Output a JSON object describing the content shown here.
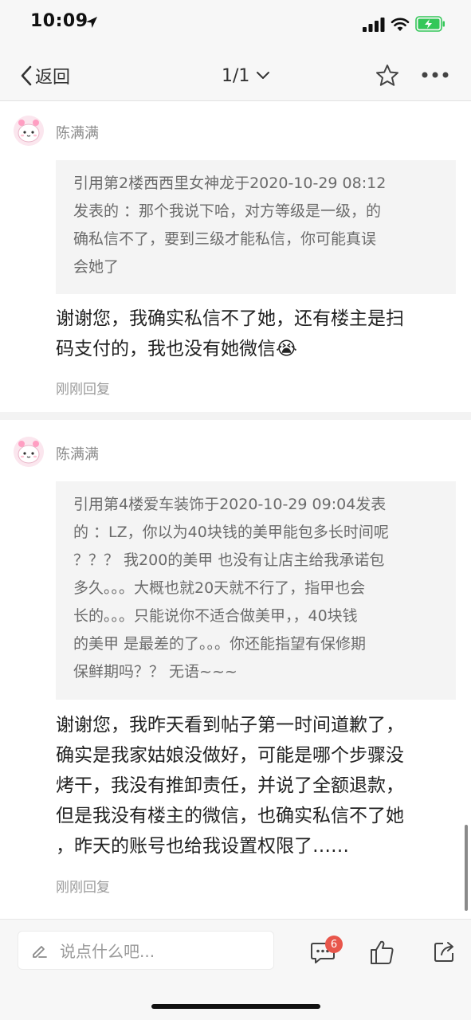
{
  "status_bar": {
    "time": "10:09",
    "battery_color": "#34c759"
  },
  "nav": {
    "back_label": "返回",
    "page_indicator": "1/1"
  },
  "posts": [
    {
      "username": "陈满满",
      "quote_lines": [
        "引用第2楼西西里女神龙于2020-10-29 08:12",
        "发表的 ：那个我说下哈，对方等级是一级，的",
        "确私信不了，要到三级才能私信，你可能真误",
        "会她了"
      ],
      "reply_lines": [
        "谢谢您，我确实私信不了她，还有楼主是扫",
        "码支付的，我也没有她微信"
      ],
      "emoji": "😭",
      "reply_action": "刚刚回复"
    },
    {
      "username": "陈满满",
      "quote_lines": [
        "引用第4楼爱车装饰于2020-10-29 09:04发表",
        "的 ：LZ，你以为40块钱的美甲能包多长时间呢",
        "？？？ 我200的美甲 也没有让店主给我承诺包",
        "多久。。。大概也就20天就不行了，指甲也会",
        "长的。。。只能说你不适合做美甲，，40块钱",
        "的美甲 是最差的了。。。你还能指望有保修期",
        "保鲜期吗？？ 无语~~~"
      ],
      "reply_lines": [
        "谢谢您，我昨天看到帖子第一时间道歉了，",
        "确实是我家姑娘没做好，可能是哪个步骤没",
        "烤干，我没有推卸责任，并说了全额退款，",
        "但是我没有楼主的微信，也确实私信不了她",
        "，昨天的账号也给我设置权限了……"
      ],
      "reply_action": "刚刚回复"
    }
  ],
  "bottom_bar": {
    "input_placeholder": "说点什么吧...",
    "comment_count": "6",
    "badge_color": "#e8564b"
  }
}
